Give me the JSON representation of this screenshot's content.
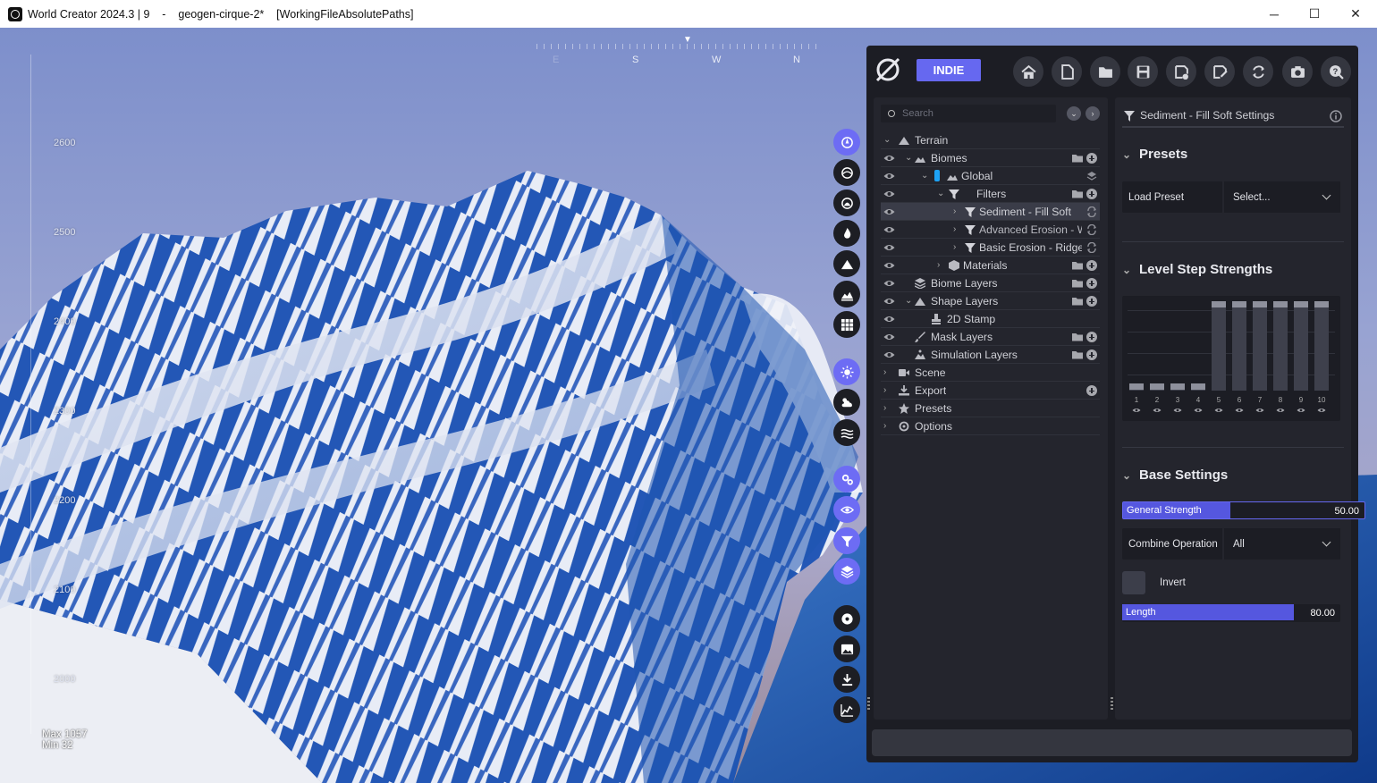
{
  "window": {
    "title": "World Creator 2024.3 | 9    -    geogen-cirque-2*    [WorkingFileAbsolutePaths]",
    "minimize": "─",
    "maximize": "☐",
    "close": "✕"
  },
  "viewport": {
    "compass": [
      "E",
      "S",
      "W",
      "N"
    ],
    "ruler": [
      "2600",
      "2500",
      "2400",
      "2300",
      "2200",
      "2100",
      "2000"
    ],
    "max": "Max 1057",
    "min": "Min 32"
  },
  "side_toolbar": [
    {
      "name": "terrain-mode-button",
      "icon": "compass-icon",
      "active": true
    },
    {
      "name": "biome-mode-button",
      "icon": "globe-icon",
      "active": false
    },
    {
      "name": "sculpt-mode-button",
      "icon": "dome-icon",
      "active": false
    },
    {
      "name": "erosion-mode-button",
      "icon": "flame-icon",
      "active": false
    },
    {
      "name": "mountain-mode-button",
      "icon": "mountain-icon",
      "active": false
    },
    {
      "name": "landscape-mode-button",
      "icon": "landscape-icon",
      "active": false
    },
    {
      "name": "grid-mode-button",
      "icon": "grid-icon",
      "active": false
    },
    {
      "name": "sun-button",
      "icon": "sun-icon",
      "active": true
    },
    {
      "name": "clouds-button",
      "icon": "cloud-icon",
      "active": false
    },
    {
      "name": "water-button",
      "icon": "waves-icon",
      "active": false
    },
    {
      "name": "render-settings-button",
      "icon": "gears-icon",
      "active": true
    },
    {
      "name": "visibility-button",
      "icon": "eye-icon",
      "active": true
    },
    {
      "name": "filter-button",
      "icon": "funnel-icon",
      "active": true
    },
    {
      "name": "layers-button",
      "icon": "layers-icon",
      "active": true
    },
    {
      "name": "record-button",
      "icon": "disc-icon",
      "active": false
    },
    {
      "name": "image-button",
      "icon": "image-icon",
      "active": false
    },
    {
      "name": "download-button",
      "icon": "download-icon",
      "active": false
    },
    {
      "name": "stats-button",
      "icon": "chart-icon",
      "active": false
    }
  ],
  "toolbar": {
    "badge": "INDIE",
    "buttons": [
      "home-icon",
      "new-file-icon",
      "open-folder-icon",
      "save-icon",
      "save-as-icon",
      "export-icon",
      "sync-icon",
      "camera-icon",
      "help-icon"
    ]
  },
  "tree": {
    "search_placeholder": "Search",
    "items": [
      {
        "label": "Terrain"
      },
      {
        "label": "Biomes"
      },
      {
        "label": "Global"
      },
      {
        "label": "Filters"
      },
      {
        "label": "Sediment - Fill Soft"
      },
      {
        "label": "Advanced Erosion - W"
      },
      {
        "label": "Basic Erosion - Ridged"
      },
      {
        "label": "Materials"
      },
      {
        "label": "Biome Layers"
      },
      {
        "label": "Shape Layers"
      },
      {
        "label": "2D Stamp"
      },
      {
        "label": "Mask Layers"
      },
      {
        "label": "Simulation Layers"
      },
      {
        "label": "Scene"
      },
      {
        "label": "Export"
      },
      {
        "label": "Presets"
      },
      {
        "label": "Options"
      }
    ]
  },
  "settings": {
    "header": "Sediment - Fill Soft Settings",
    "presets": {
      "title": "Presets",
      "load_label": "Load Preset",
      "load_value": "Select..."
    },
    "level_steps": {
      "title": "Level Step Strengths",
      "labels": [
        "1",
        "2",
        "3",
        "4",
        "5",
        "6",
        "7",
        "8",
        "9",
        "10"
      ],
      "values": [
        0.05,
        0.05,
        0.05,
        0.05,
        1,
        1,
        1,
        1,
        1,
        1
      ]
    },
    "base": {
      "title": "Base Settings",
      "general_strength_label": "General Strength",
      "general_strength_value": "50.00",
      "general_strength_fraction": 0.5,
      "combine_label": "Combine Operation",
      "combine_value": "All",
      "invert_label": "Invert",
      "length_label": "Length",
      "length_value": "80.00",
      "length_fraction": 0.8
    }
  },
  "colors": {
    "accent": "#6668f0",
    "panel": "#24252d",
    "terrain_blue": "#1f55b0",
    "snow": "#e7ecf6"
  }
}
